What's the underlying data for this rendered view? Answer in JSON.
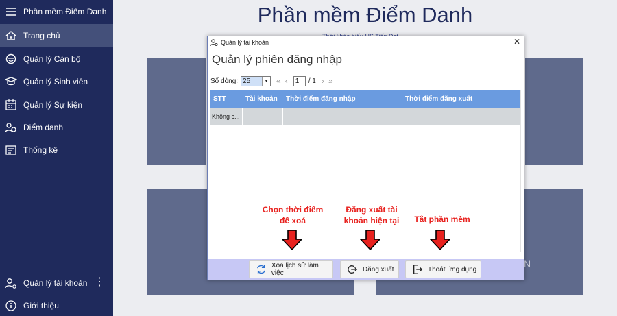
{
  "sidebar": {
    "app_title": "Phần mềm Điểm Danh",
    "items": [
      {
        "label": "Trang chủ"
      },
      {
        "label": "Quản lý Cán bộ"
      },
      {
        "label": "Quản lý Sinh viên"
      },
      {
        "label": "Quản lý Sự kiện"
      },
      {
        "label": "Điểm danh"
      },
      {
        "label": "Thống kê"
      }
    ],
    "bottom": [
      {
        "label": "Quản lý tài khoản"
      },
      {
        "label": "Giới thiệu"
      }
    ],
    "colors": {
      "bg": "#1f2a5c",
      "active": "#44507a"
    }
  },
  "main": {
    "title": "Phần mềm Điểm Danh",
    "subtitle": "Thời khóa biểu HS Tiến Đạt",
    "card_text": "N"
  },
  "dialog": {
    "window_title": "Quản lý tài khoản",
    "heading": "Quản lý phiên đăng nhập",
    "pager": {
      "rows_label": "Số dòng:",
      "rows_value": "25",
      "page_value": "1",
      "total_label": "/ 1"
    },
    "grid": {
      "columns": [
        "STT",
        "Tài khoản",
        "Thời điểm đăng nhập",
        "Thời điểm đăng xuất"
      ],
      "rows": [
        [
          "Không c...",
          "",
          "",
          ""
        ]
      ]
    },
    "buttons": {
      "clear_history": "Xoá lịch sử làm việc",
      "logout": "Đăng xuất",
      "exit_app": "Thoát ứng dụng"
    },
    "accent": "#6a9be0",
    "footer_color": "#c7c8f5"
  },
  "annotations": {
    "clear_note_line1": "Chọn thời điểm",
    "clear_note_line2": "để xoá",
    "logout_note_line1": "Đăng xuất tài",
    "logout_note_line2": "khoản hiện tại",
    "exit_note": "Tắt phần mềm",
    "color": "#e8221f"
  }
}
